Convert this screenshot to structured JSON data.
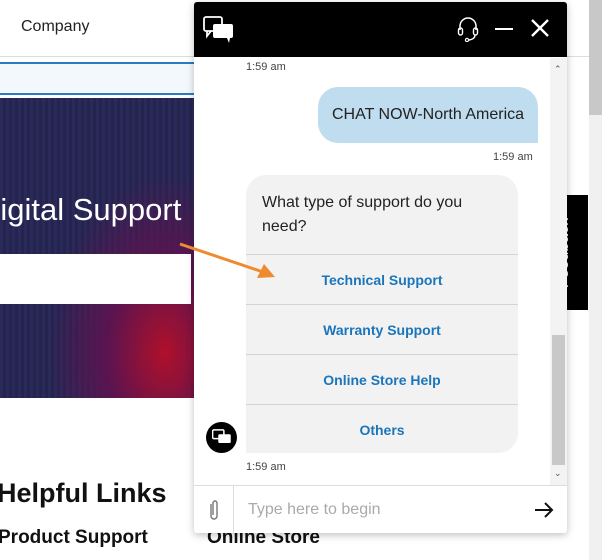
{
  "nav": {
    "company": "Company"
  },
  "hero": {
    "title": "Digital Support"
  },
  "sections": {
    "helpful": "Helpful Links",
    "product_support": "Product Support",
    "online_store": "Online Store"
  },
  "feedback": "Feedback",
  "chat": {
    "top_timestamp": "1:59 am",
    "user_message": "CHAT NOW-North America",
    "user_timestamp": "1:59 am",
    "bot_question": "What type of support do you need?",
    "options": [
      "Technical Support",
      "Warranty Support",
      "Online Store Help",
      "Others"
    ],
    "bot_timestamp": "1:59 am",
    "input_placeholder": "Type here to begin"
  },
  "colors": {
    "accent": "#1b75bb",
    "user_bubble": "#c0dcef",
    "arrow": "#f08a30"
  },
  "icons": {
    "header_left": "chat-bubbles-icon",
    "headset": "headset-icon",
    "minimize": "minimize-icon",
    "close": "close-icon",
    "attach": "paperclip-icon",
    "send": "arrow-right-icon"
  }
}
